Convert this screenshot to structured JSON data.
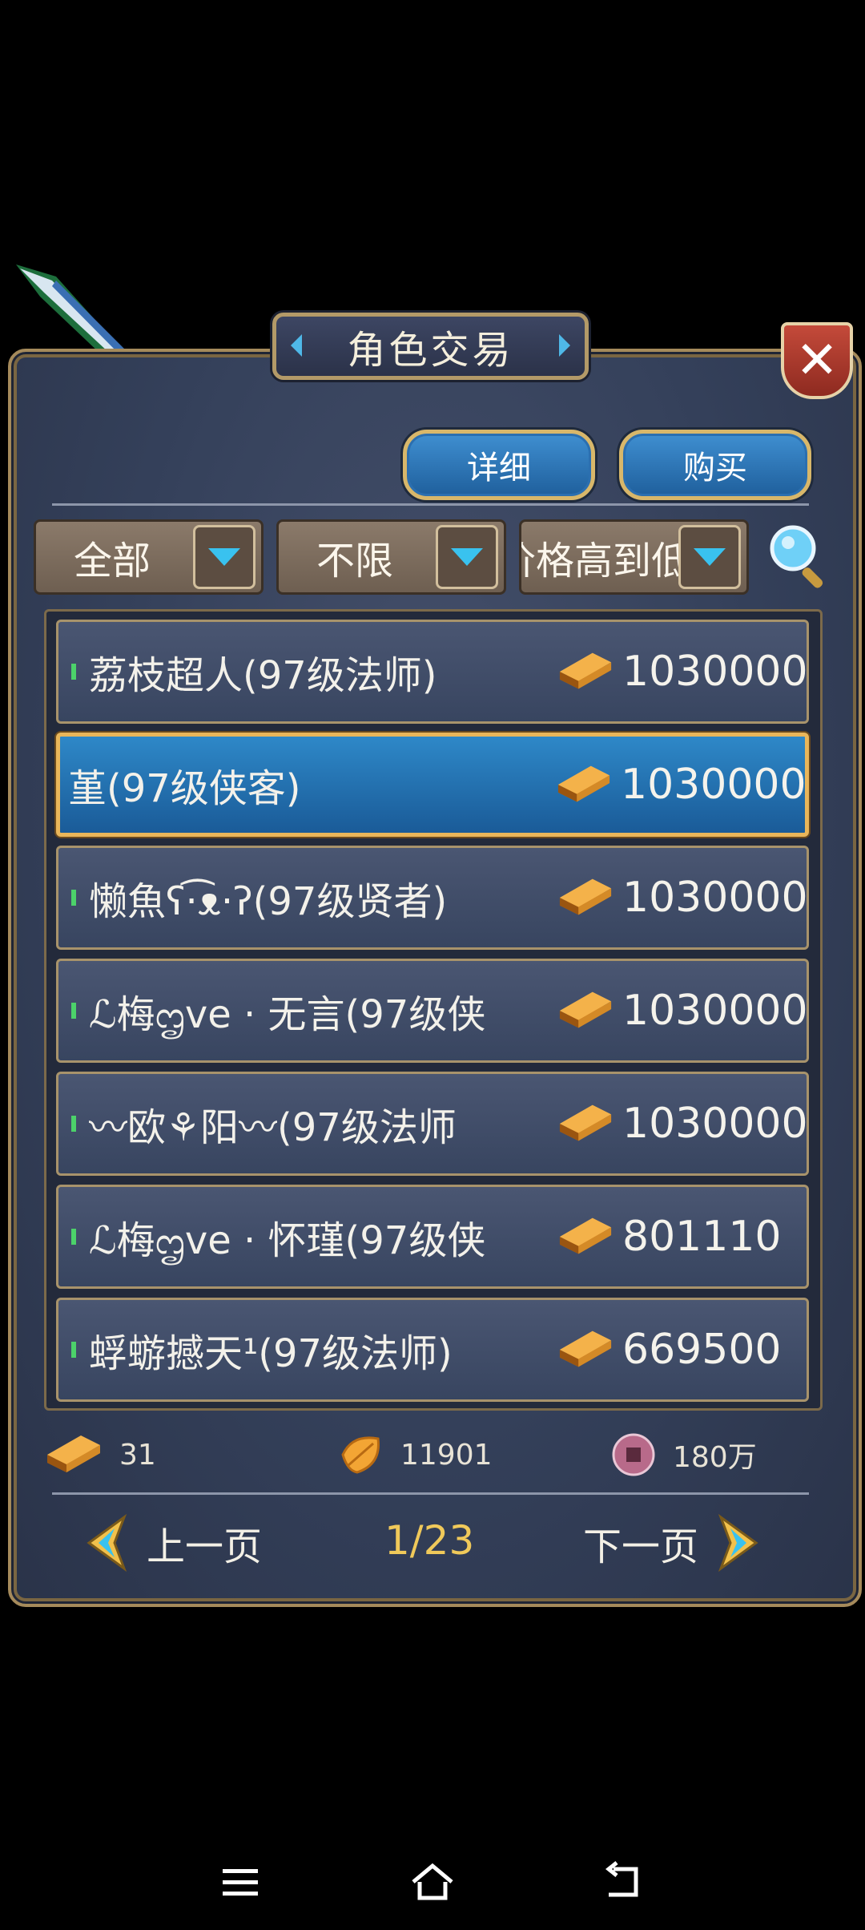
{
  "title": "角色交易",
  "buttons": {
    "detail": "详细",
    "buy": "购买",
    "close": "✕"
  },
  "filters": {
    "category": "全部",
    "limit": "不限",
    "sort": "价格高到低"
  },
  "listings": [
    {
      "name": "荔枝超人(97级法师)",
      "price": "1030000",
      "selected": false
    },
    {
      "name": "堇(97级侠客)",
      "price": "1030000",
      "selected": true
    },
    {
      "name": "懒魚ʕ·͡ᴥ·ʔ(97级贤者)",
      "price": "1030000",
      "selected": false
    },
    {
      "name": "ℒ梅ᦗve · 无言(97级侠",
      "price": "1030000",
      "selected": false
    },
    {
      "name": "〰欧⚘阳〰(97级法师",
      "price": "1030000",
      "selected": false
    },
    {
      "name": "ℒ梅ᦗve · 怀瑾(97级侠",
      "price": "801110",
      "selected": false
    },
    {
      "name": "蜉蝣撼天¹(97级法师)",
      "price": "669500",
      "selected": false
    }
  ],
  "currencies": {
    "gold": "31",
    "leaf": "11901",
    "coin": "180万"
  },
  "paging": {
    "prev": "上一页",
    "next": "下一页",
    "current": "1/23"
  },
  "icons": {
    "ingot": "gold-ingot-icon",
    "leaf": "leaf-currency-icon",
    "coin": "copper-coin-icon",
    "search": "magnifier-icon"
  },
  "colors": {
    "selected_row": "#1f6fb0",
    "page_number": "#f0c95a",
    "accent_border": "#d8b76a"
  }
}
